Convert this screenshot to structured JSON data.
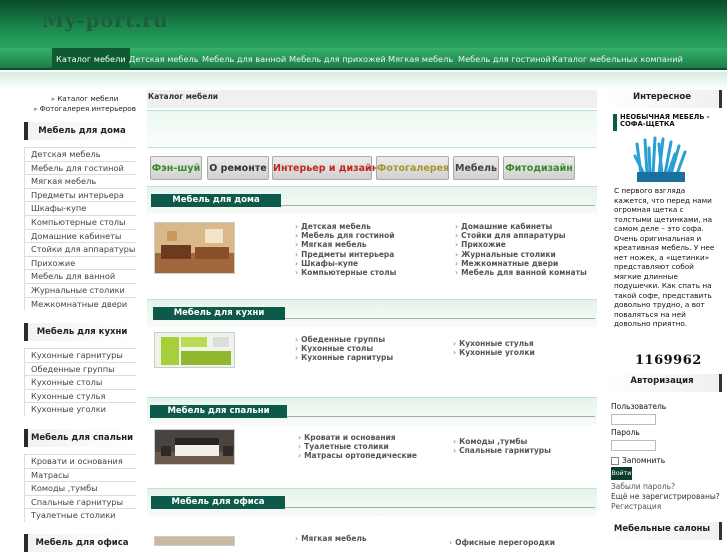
{
  "logo": "My-port.ru",
  "nav": [
    "Каталог мебели",
    "Детская мебель",
    "Мебель для ванной",
    "Мебель для прихожей",
    "Мягкая мебель",
    "Мебель для гостиной",
    "Каталог мебельных компаний"
  ],
  "left_top": [
    "Каталог мебели",
    "Фотогалерея интерьеров"
  ],
  "left_sections": [
    {
      "title": "Мебель для дома",
      "items": [
        "Детская мебель",
        "Мебель для гостиной",
        "Мягкая мебель",
        "Предметы интерьера",
        "Шкафы-купе",
        "Компьютерные столы",
        "Домашние кабинеты",
        "Стойки для аппаратуры",
        "Прихожие",
        "Мебель для ванной",
        "Журнальные столики",
        "Межкомнатные двери"
      ]
    },
    {
      "title": "Мебель для кухни",
      "items": [
        "Кухонные гарнитуры",
        "Обеденные группы",
        "Кухонные столы",
        "Кухонные стулья",
        "Кухонные уголки"
      ]
    },
    {
      "title": "Мебель для спальни",
      "items": [
        "Кровати и основания",
        "Матрасы",
        "Комоды ,тумбы",
        "Спальные гарнитуры",
        "Туалетные столики"
      ]
    },
    {
      "title": "Мебель для офиса",
      "items": []
    }
  ],
  "center": {
    "title": "Каталог мебели",
    "categories": [
      {
        "label": "Фэн-шуй",
        "color": "#3a8a2a"
      },
      {
        "label": "О ремонте",
        "color": "#333333"
      },
      {
        "label": "Интерьер и дизайн",
        "color": "#c0281e"
      },
      {
        "label": "Фотогалерея",
        "color": "#a6962a"
      },
      {
        "label": "Мебель",
        "color": "#444444"
      },
      {
        "label": "Фитодизайн",
        "color": "#3a8a2a"
      }
    ],
    "sections": [
      {
        "title": "Мебель для дома",
        "col1": [
          "Детская мебель",
          "Мебель для гостиной",
          "Мягкая мебель",
          "Предметы интерьера",
          "Шкафы-купе",
          "Компьютерные столы"
        ],
        "col2": [
          "Домашние кабинеты",
          "Стойки для аппаратуры",
          "Прихожие",
          "Журнальные столики",
          "Межкомнатные двери",
          "Мебель для ванной комнаты"
        ]
      },
      {
        "title": "Мебель для кухни",
        "col1": [
          "Обеденные группы",
          "Кухонные столы",
          "Кухонные гарнитуры"
        ],
        "col2": [
          "Кухонные стулья",
          "Кухонные уголки"
        ]
      },
      {
        "title": "Мебель для спальни",
        "col1": [
          "Кровати и основания",
          "Туалетные столики",
          "Матрасы ортопедические"
        ],
        "col2": [
          "Комоды ,тумбы",
          "Спальные гарнитуры"
        ]
      },
      {
        "title": "Мебель для офиса",
        "col1": [
          "Мягкая мебель"
        ],
        "col2": [
          "Офисные перегородки"
        ]
      }
    ]
  },
  "right": {
    "interesting_title": "Интересное",
    "article_title": "НЕОБЫЧНАЯ МЕБЕЛЬ - СОФА-ЩЕТКА",
    "article_text": "С первого взгляда кажется, что перед нами огромная щетка с толстыми щетинками, на самом деле – это софа. Очень оригинальная и креативная мебель. У нее нет ножек, а «щетинки» представляют собой мягкие длинные подушечки. Как спать на такой софе, представить довольно трудно, а вот поваляться на ней довольно приятно.",
    "counter": "1169962",
    "auth_title": "Авторизация",
    "user_label": "Пользователь",
    "pass_label": "Пароль",
    "remember_label": "Запомнить",
    "login_button": "Войти",
    "forgot": "Забыли пароль?",
    "not_registered": "Ещё не зарегистрированы?",
    "register": "Регистрация",
    "salons_title": "Мебельные салоны"
  }
}
